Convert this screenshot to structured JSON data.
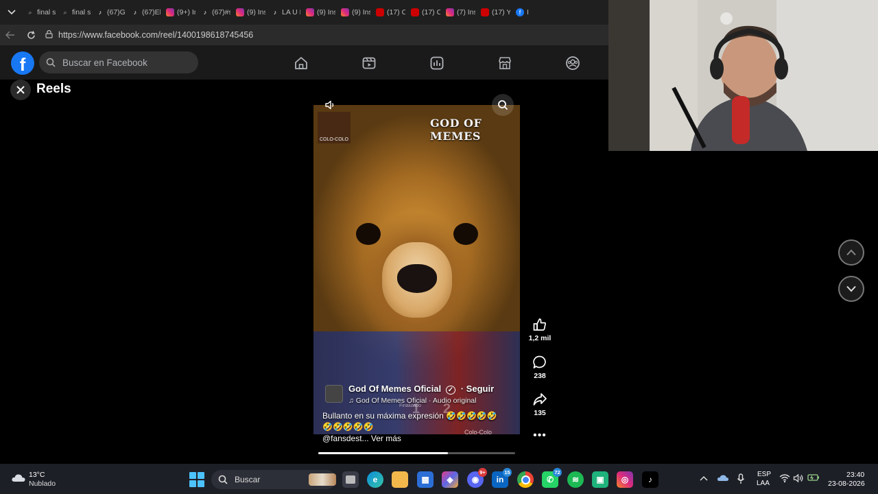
{
  "browser": {
    "tabs": [
      {
        "icon": "search",
        "label": "final sc"
      },
      {
        "icon": "search",
        "label": "final sc"
      },
      {
        "icon": "tiktok",
        "label": "(67)Ga"
      },
      {
        "icon": "tiktok",
        "label": "(67)El e"
      },
      {
        "icon": "insta",
        "label": "(9+) In"
      },
      {
        "icon": "tiktok",
        "label": "(67)#s"
      },
      {
        "icon": "insta",
        "label": "(9) Inst"
      },
      {
        "icon": "tiktok",
        "label": "LA U F"
      },
      {
        "icon": "insta",
        "label": "(9) Inst"
      },
      {
        "icon": "insta",
        "label": "(9) Inst"
      },
      {
        "icon": "yt",
        "label": "(17) Cc"
      },
      {
        "icon": "yt",
        "label": "(17) Cc"
      },
      {
        "icon": "insta",
        "label": "(7) Inst"
      },
      {
        "icon": "yt",
        "label": "(17) Yo"
      },
      {
        "icon": "fb",
        "label": "I"
      }
    ],
    "url": "https://www.facebook.com/reel/1400198618745456"
  },
  "facebook": {
    "logo_letter": "f",
    "search_placeholder": "Buscar en Facebook",
    "nav_icons": [
      "home-icon",
      "video-icon",
      "feeds-icon",
      "marketplace-icon",
      "groups-icon"
    ]
  },
  "reels": {
    "title": "Reels",
    "overlay": {
      "brand": "GOD OF MEMES",
      "badge_text": "COLO-COLO",
      "score_left": "1",
      "score_right": "2",
      "score_status": "Finalizado",
      "team_label": "Colo-Colo"
    },
    "author": "God Of Memes Oficial",
    "verified": "✓",
    "follow_text": "· Seguir",
    "audio": "God Of Memes Oficial · Audio original",
    "caption_line1": "Bullanto en su máxima expresión 🤣🤣🤣🤣🤣",
    "caption_line2": "🤣🤣🤣🤣🤣",
    "caption_line3": "@fansdest... Ver más",
    "progress": 0.66,
    "actions": {
      "likes": "1,2 mil",
      "comments": "238",
      "shares": "135"
    }
  },
  "taskbar": {
    "temperature": "13°C",
    "weather": "Nublado",
    "search_placeholder": "Buscar",
    "badges": {
      "discord": "9+",
      "linkedin": "15",
      "whatsapp": "72"
    },
    "lang_line1": "ESP",
    "lang_line2": "LAA",
    "time": "23:40",
    "date": "23-08-2026"
  },
  "colors": {
    "facebook_blue": "#1877f2",
    "taskbar_bg": "#1d1f27"
  }
}
